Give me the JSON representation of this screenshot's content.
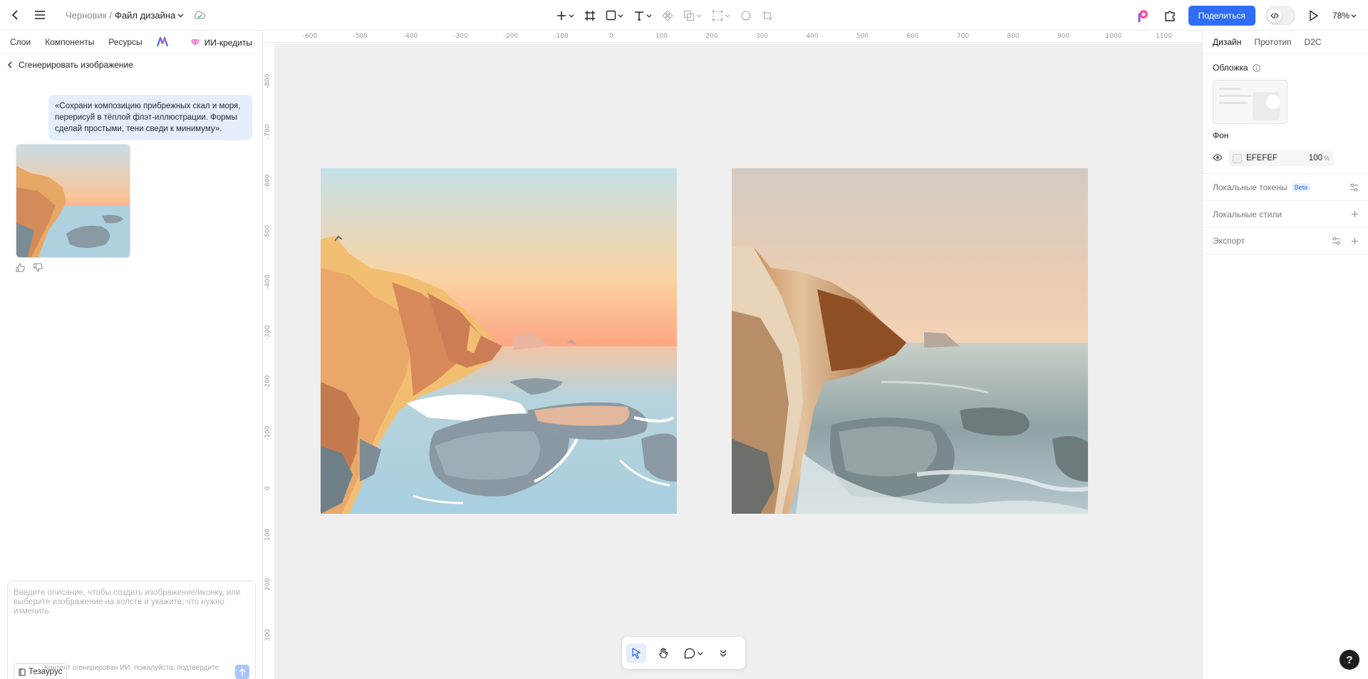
{
  "topbar": {
    "breadcrumb_draft": "Черновик",
    "breadcrumb_sep": "/",
    "file_name": "Файл дизайна",
    "share_label": "Поделиться",
    "zoom_label": "78%"
  },
  "left_panel": {
    "tabs": [
      "Слои",
      "Компоненты",
      "Ресурсы"
    ],
    "credits_label": "ИИ-кредиты",
    "back_label": "Сгенерировать изображение",
    "message_text": "«Сохрани композицию прибрежных скал и моря, перерисуй в тёплой флэт-иллюстрации. Формы сделай простыми, тени сведи к минимуму».",
    "prompt_placeholder": "Введите описание, чтобы создать изображение/иконку, или выберите изображение на холсте и укажите, что нужно изменить",
    "thesaurus_label": "Тезаурус",
    "ai_note": "Контент сгенерирован ИИ, пожалуйста, подтвердите"
  },
  "rulers": {
    "top_ticks": [
      "-600",
      "-500",
      "-400",
      "-300",
      "-200",
      "-100",
      "0",
      "100",
      "200",
      "300",
      "400",
      "500",
      "600",
      "700",
      "800",
      "900",
      "1000",
      "1100"
    ],
    "left_ticks": [
      "-800",
      "-700",
      "-600",
      "-500",
      "-400",
      "-300",
      "-200",
      "-100",
      "0",
      "100",
      "200",
      "300",
      "400"
    ]
  },
  "right_panel": {
    "tabs": [
      "Дизайн",
      "Прототип",
      "D2C"
    ],
    "cover_title": "Обложка",
    "bg_title": "Фон",
    "bg_color": "EFEFEF",
    "bg_opacity": "100",
    "bg_opacity_unit": "%",
    "local_tokens": "Локальные токены",
    "beta_badge": "Beta",
    "local_styles": "Локальные стили",
    "export": "Экспорт"
  },
  "colors": {
    "accent": "#2f6df6",
    "canvas_bg": "#EFEFEF"
  },
  "help_label": "?"
}
